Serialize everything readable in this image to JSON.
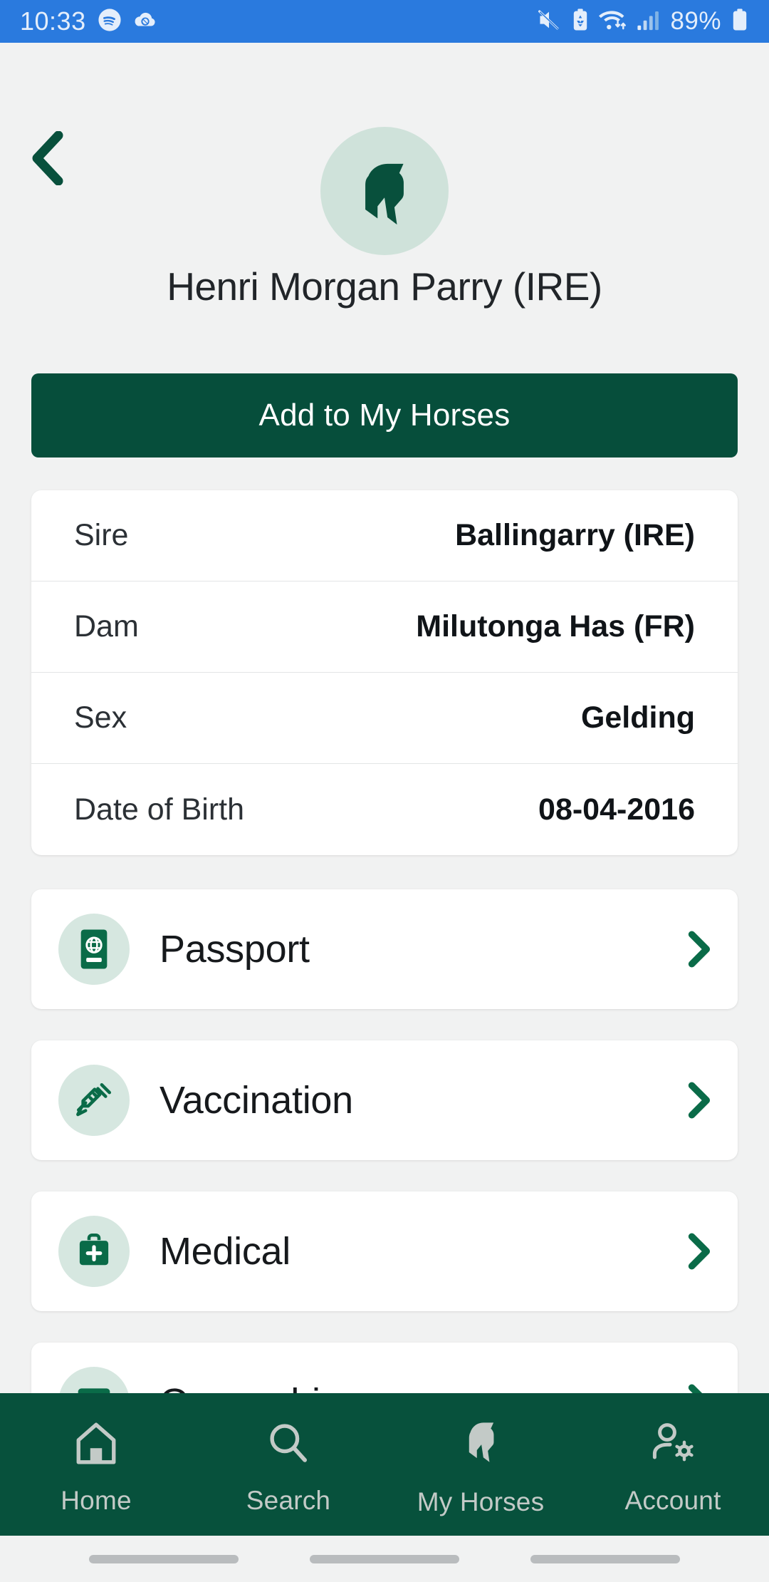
{
  "status_bar": {
    "time": "10:33",
    "battery_percent": "89%",
    "left_icons": [
      "spotify-icon",
      "cloud-sync-icon"
    ],
    "right_icons": [
      "mute-icon",
      "battery-saver-icon",
      "wifi-icon",
      "cellular-signal-icon",
      "battery-icon"
    ],
    "background_color": "#2a7ade"
  },
  "header": {
    "back_label": "back-chevron",
    "avatar_icon": "horse-head-icon",
    "title": "Henri Morgan Parry (IRE)"
  },
  "primary_action": {
    "label": "Add to My Horses",
    "color": "#064e3b"
  },
  "details": {
    "rows": [
      {
        "label": "Sire",
        "value": "Ballingarry (IRE)"
      },
      {
        "label": "Dam",
        "value": "Milutonga Has (FR)"
      },
      {
        "label": "Sex",
        "value": "Gelding"
      },
      {
        "label": "Date of Birth",
        "value": "08-04-2016"
      }
    ]
  },
  "menu": {
    "items": [
      {
        "label": "Passport",
        "icon": "passport-book-icon"
      },
      {
        "label": "Vaccination",
        "icon": "syringe-icon"
      },
      {
        "label": "Medical",
        "icon": "medical-bag-icon"
      },
      {
        "label": "Ownership",
        "icon": "certificate-icon"
      }
    ]
  },
  "bottom_nav": {
    "items": [
      {
        "label": "Home",
        "icon": "home-icon"
      },
      {
        "label": "Search",
        "icon": "search-icon"
      },
      {
        "label": "My Horses",
        "icon": "horse-head-icon"
      },
      {
        "label": "Account",
        "icon": "account-gear-icon"
      }
    ],
    "background_color": "#07513c"
  },
  "theme": {
    "accent_green": "#064e3b",
    "icon_bubble": "#d6e7e0",
    "page_background": "#f1f2f2"
  }
}
